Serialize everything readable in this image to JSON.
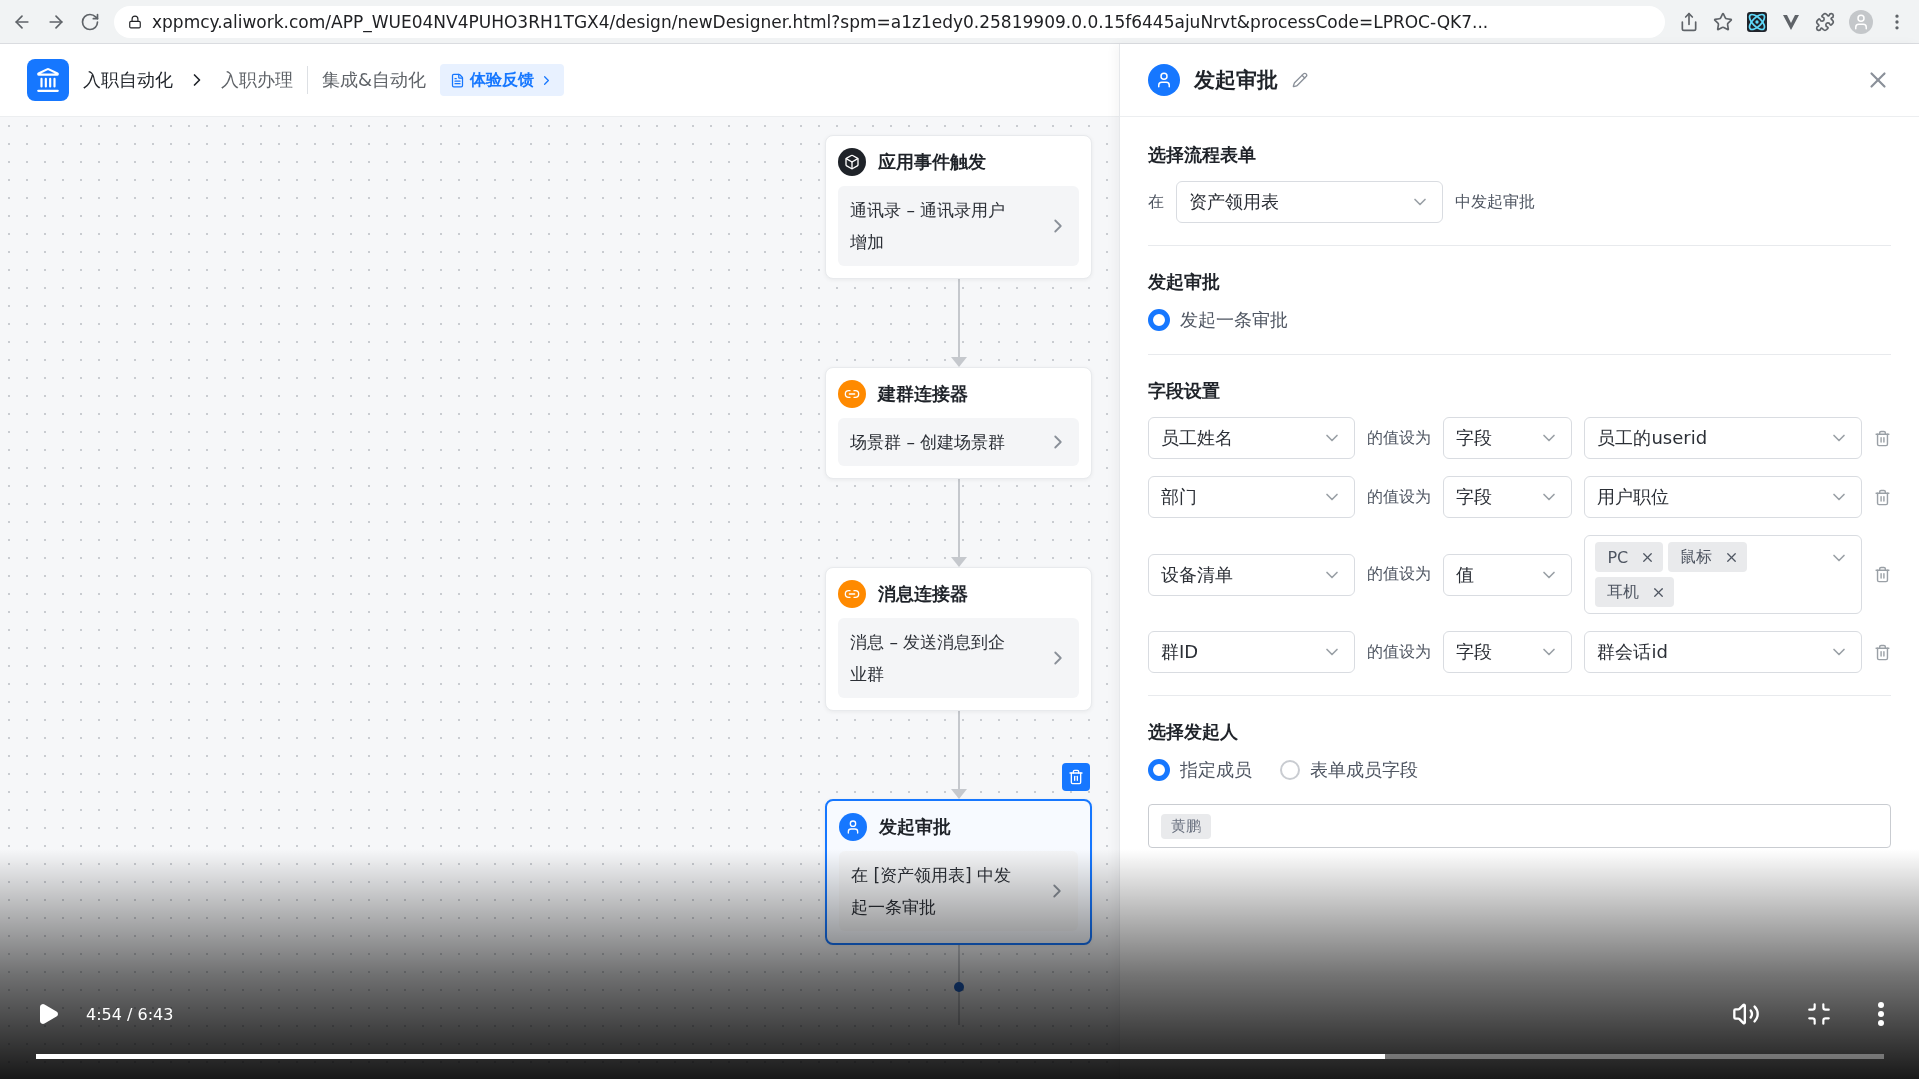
{
  "browser": {
    "url": "xppmcy.aliwork.com/APP_WUE04NV4PUHO3RH1TGX4/design/newDesigner.html?spm=a1z1edy0.25819909.0.0.15f6445ajuNrvt&processCode=LPROC-QK7..."
  },
  "header": {
    "breadcrumb": [
      "入职自动化",
      "入职办理"
    ],
    "nav": "集成&自动化",
    "feedback": "体验反馈"
  },
  "nodes": [
    {
      "kind": "trigger",
      "title": "应用事件触发",
      "detail": "通讯录 – 通讯录用户增加",
      "selected": false
    },
    {
      "kind": "connector",
      "title": "建群连接器",
      "detail": "场景群 – 创建场景群",
      "selected": false
    },
    {
      "kind": "connector",
      "title": "消息连接器",
      "detail": "消息 – 发送消息到企业群",
      "selected": false
    },
    {
      "kind": "approval",
      "title": "发起审批",
      "detail": "在 [资产领用表] 中发起一条审批",
      "selected": true
    }
  ],
  "panel": {
    "title": "发起审批",
    "form_section": {
      "heading": "选择流程表单",
      "prefix": "在",
      "value": "资产领用表",
      "suffix": "中发起审批"
    },
    "approval_section": {
      "heading": "发起审批",
      "options": [
        {
          "label": "发起一条审批",
          "selected": true
        }
      ]
    },
    "fields_section": {
      "heading": "字段设置",
      "rows": [
        {
          "field": "员工姓名",
          "connector": "的值设为",
          "type": "字段",
          "value": "员工的userid"
        },
        {
          "field": "部门",
          "connector": "的值设为",
          "type": "字段",
          "value": "用户职位"
        },
        {
          "field": "设备清单",
          "connector": "的值设为",
          "type": "值",
          "tags": [
            "PC",
            "鼠标",
            "耳机"
          ]
        },
        {
          "field": "群ID",
          "connector": "的值设为",
          "type": "字段",
          "value": "群会话id"
        }
      ]
    },
    "initiator_section": {
      "heading": "选择发起人",
      "options": [
        {
          "label": "指定成员",
          "selected": true
        },
        {
          "label": "表单成员字段",
          "selected": false
        }
      ],
      "members": [
        "黄鹏"
      ]
    }
  },
  "player": {
    "time": "4:54 / 6:43",
    "level": 0.73
  }
}
